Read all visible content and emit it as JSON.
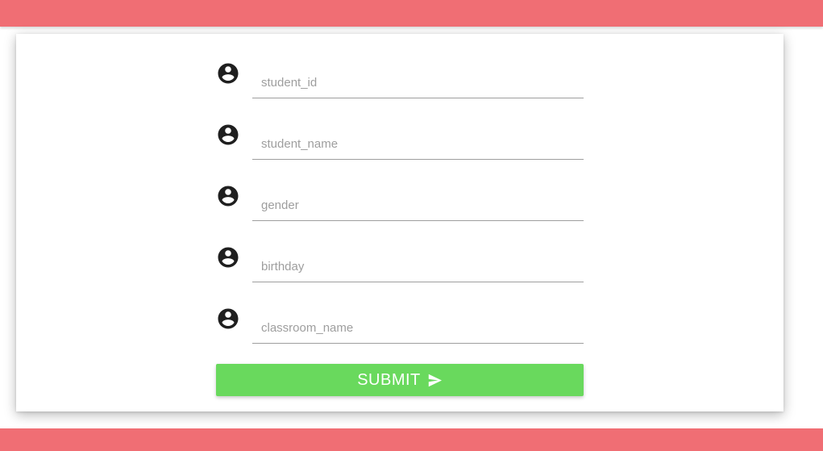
{
  "form": {
    "fields": [
      {
        "placeholder": "student_id",
        "value": "",
        "icon": "account-circle-icon"
      },
      {
        "placeholder": "student_name",
        "value": "",
        "icon": "account-circle-icon"
      },
      {
        "placeholder": "gender",
        "value": "",
        "icon": "account-circle-icon"
      },
      {
        "placeholder": "birthday",
        "value": "",
        "icon": "account-circle-icon"
      },
      {
        "placeholder": "classroom_name",
        "value": "",
        "icon": "account-circle-icon"
      }
    ],
    "submit_label": "SUBMIT",
    "submit_icon": "send-icon"
  },
  "colors": {
    "header_bar": "#f06e74",
    "footer_bar": "#f06e74",
    "submit_button": "#69d95d",
    "icon": "#1f1f1f"
  }
}
